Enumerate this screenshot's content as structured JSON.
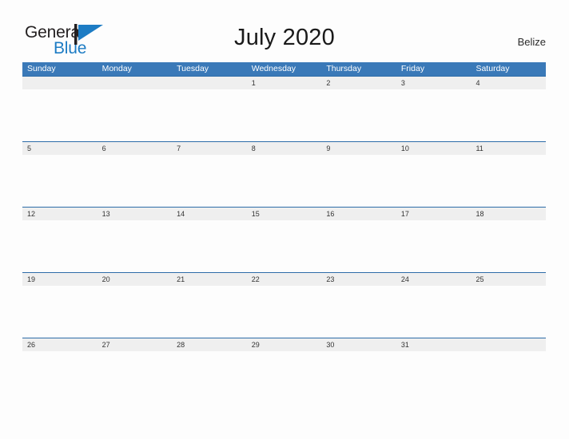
{
  "header": {
    "logo": {
      "text_primary": "General",
      "text_secondary": "Blue",
      "icon": "flag-triangle-icon",
      "color_primary": "#231f20",
      "color_secondary": "#1d7cc4"
    },
    "title": "July 2020",
    "country": "Belize"
  },
  "calendar": {
    "accent_color": "#3a79b8",
    "separator_color": "#2d6ca8",
    "date_strip_color": "#efefef",
    "weekdays": [
      "Sunday",
      "Monday",
      "Tuesday",
      "Wednesday",
      "Thursday",
      "Friday",
      "Saturday"
    ],
    "weeks": [
      [
        "",
        "",
        "",
        "1",
        "2",
        "3",
        "4"
      ],
      [
        "5",
        "6",
        "7",
        "8",
        "9",
        "10",
        "11"
      ],
      [
        "12",
        "13",
        "14",
        "15",
        "16",
        "17",
        "18"
      ],
      [
        "19",
        "20",
        "21",
        "22",
        "23",
        "24",
        "25"
      ],
      [
        "26",
        "27",
        "28",
        "29",
        "30",
        "31",
        ""
      ]
    ]
  }
}
